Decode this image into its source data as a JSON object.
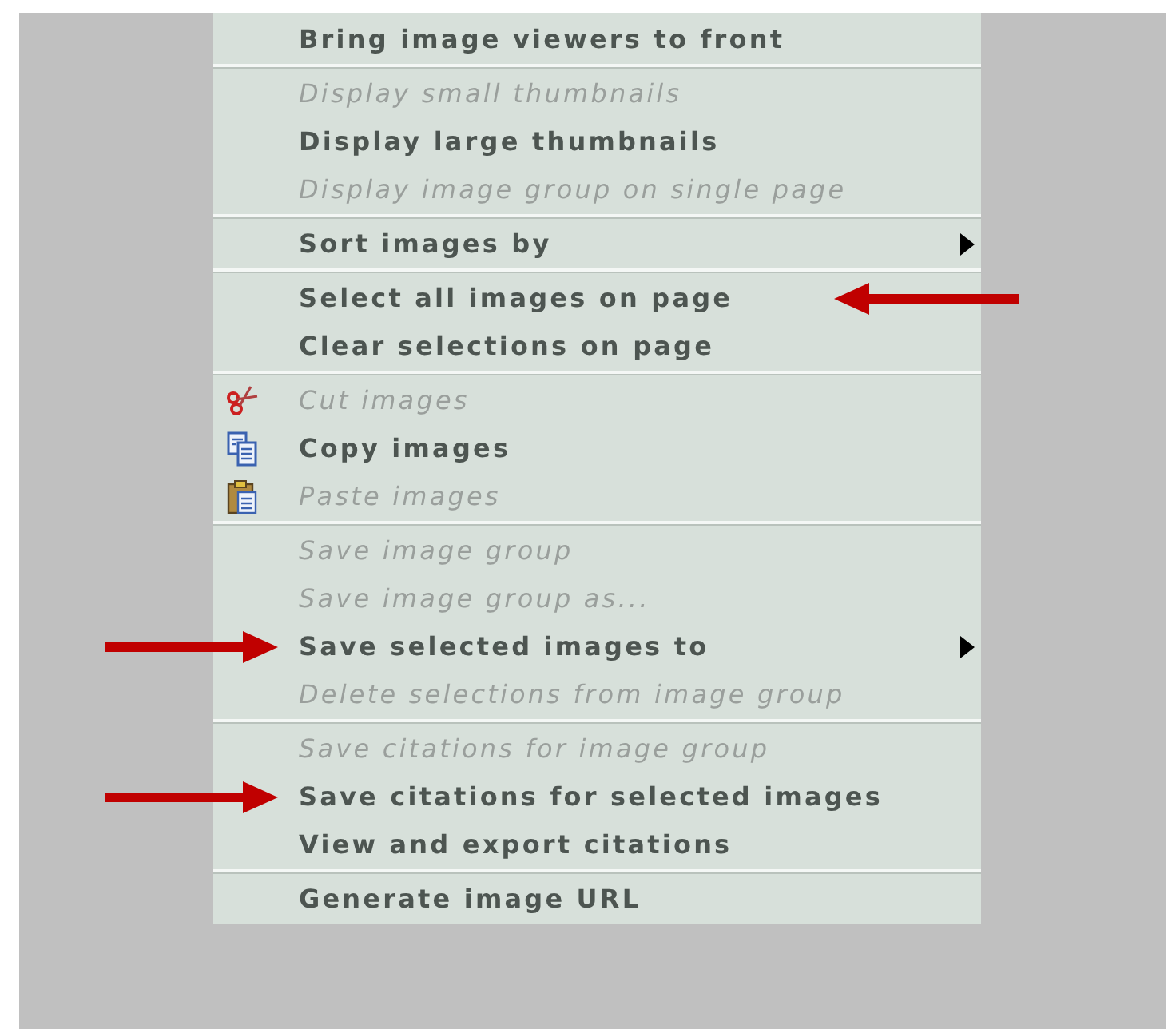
{
  "menu": {
    "groups": [
      {
        "items": [
          {
            "label": "Bring image viewers to front",
            "disabled": false
          }
        ]
      },
      {
        "items": [
          {
            "label": "Display small thumbnails",
            "disabled": true
          },
          {
            "label": "Display large thumbnails",
            "disabled": false
          },
          {
            "label": "Display image group on single page",
            "disabled": true
          }
        ]
      },
      {
        "items": [
          {
            "label": "Sort images by",
            "disabled": false,
            "submenu": true
          }
        ]
      },
      {
        "items": [
          {
            "label": "Select all images on page",
            "disabled": false,
            "kind": "pointer-right"
          },
          {
            "label": "Clear selections on page",
            "disabled": false
          }
        ]
      },
      {
        "items": [
          {
            "label": "Cut images",
            "disabled": true,
            "kind": "cut"
          },
          {
            "label": "Copy images",
            "disabled": false,
            "kind": "copy"
          },
          {
            "label": "Paste images",
            "disabled": true,
            "kind": "paste"
          }
        ]
      },
      {
        "items": [
          {
            "label": "Save image group",
            "disabled": true
          },
          {
            "label": "Save image group as...",
            "disabled": true
          },
          {
            "label": "Save selected images to",
            "disabled": false,
            "submenu": true,
            "kind": "pointer-left"
          },
          {
            "label": "Delete selections from image group",
            "disabled": true
          }
        ]
      },
      {
        "items": [
          {
            "label": "Save citations for image group",
            "disabled": true
          },
          {
            "label": "Save citations for selected images",
            "disabled": false,
            "kind": "pointer-left"
          },
          {
            "label": "View and export citations",
            "disabled": false
          }
        ]
      },
      {
        "items": [
          {
            "label": "Generate image URL",
            "disabled": false
          }
        ]
      }
    ]
  }
}
